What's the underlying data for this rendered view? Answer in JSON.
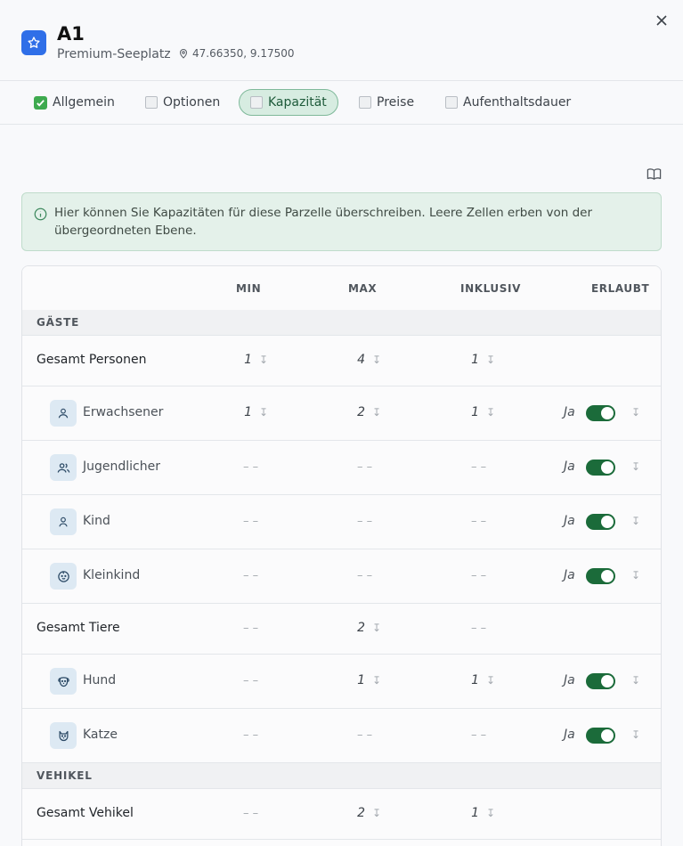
{
  "header": {
    "title": "A1",
    "subtitle": "Premium-Seeplatz",
    "coordinates": "47.66350, 9.17500",
    "accent": "#2f6fe8"
  },
  "tabs": [
    {
      "label": "Allgemein",
      "state": "done"
    },
    {
      "label": "Optionen",
      "state": "empty"
    },
    {
      "label": "Kapazität",
      "state": "active"
    },
    {
      "label": "Preise",
      "state": "empty"
    },
    {
      "label": "Aufenthaltsdauer",
      "state": "empty"
    }
  ],
  "info": {
    "text": "Hier können Sie Kapazitäten für diese Parzelle überschreiben. Leere Zellen erben von der übergeordneten Ebene."
  },
  "table": {
    "columns": [
      "",
      "MIN",
      "MAX",
      "INKLUSIV",
      "ERLAUBT"
    ],
    "dash": "– –",
    "allowed_label": "Ja",
    "sections": [
      {
        "title": "GÄSTE",
        "total": {
          "label": "Gesamt Personen",
          "min": "1",
          "max": "4",
          "inklusiv": "1"
        },
        "items": [
          {
            "label": "Erwachsener",
            "icon": "person-icon",
            "min": "1",
            "max": "2",
            "inklusiv": "1",
            "allowed": true
          },
          {
            "label": "Jugendlicher",
            "icon": "people-icon",
            "min": null,
            "max": null,
            "inklusiv": null,
            "allowed": true
          },
          {
            "label": "Kind",
            "icon": "child-icon",
            "min": null,
            "max": null,
            "inklusiv": null,
            "allowed": true
          },
          {
            "label": "Kleinkind",
            "icon": "baby-icon",
            "min": null,
            "max": null,
            "inklusiv": null,
            "allowed": true
          }
        ]
      },
      {
        "title": "",
        "total": {
          "label": "Gesamt Tiere",
          "min": null,
          "max": "2",
          "inklusiv": null
        },
        "items": [
          {
            "label": "Hund",
            "icon": "dog-icon",
            "min": null,
            "max": "1",
            "inklusiv": "1",
            "allowed": true
          },
          {
            "label": "Katze",
            "icon": "cat-icon",
            "min": null,
            "max": null,
            "inklusiv": null,
            "allowed": true
          }
        ]
      },
      {
        "title": "VEHIKEL",
        "total": {
          "label": "Gesamt Vehikel",
          "min": null,
          "max": "2",
          "inklusiv": "1"
        },
        "items": []
      }
    ]
  },
  "colors": {
    "toggle_on": "#1b6b3a",
    "info_bg": "#e4f1ea",
    "active_tab_bg": "#d7ece1"
  }
}
